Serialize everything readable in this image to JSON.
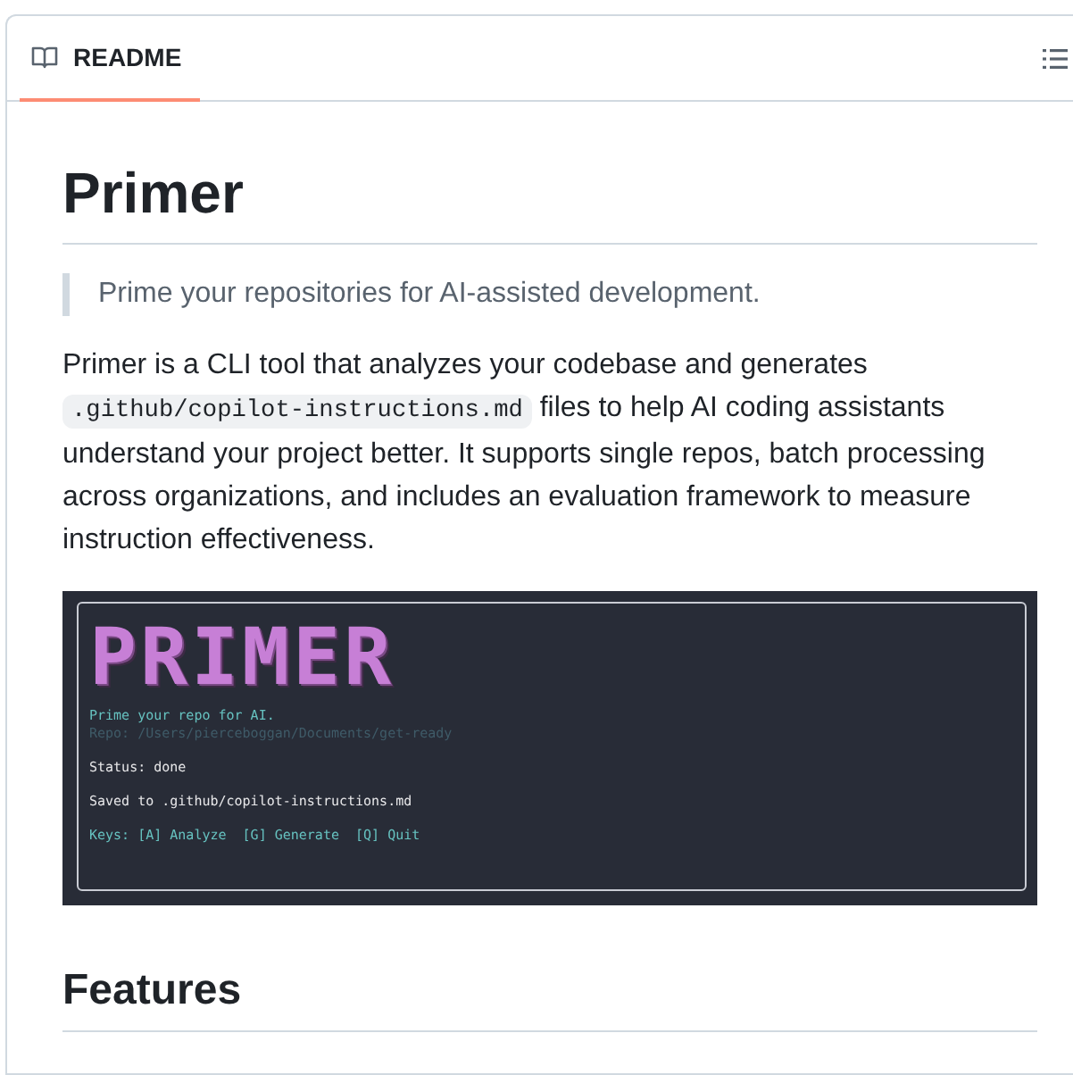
{
  "tab": {
    "label": "README",
    "selected": true
  },
  "title": "Primer",
  "quote": "Prime your repositories for AI-assisted development.",
  "intro": [
    {
      "kind": "text",
      "text": "Primer is a CLI tool that analyzes your codebase and generates "
    },
    {
      "kind": "code",
      "text": ".github/copilot-instructions.md"
    },
    {
      "kind": "text",
      "text": " files to help AI coding assistants understand your project better. It supports single repos, batch processing across organizations, and includes an evaluation framework to measure instruction effectiveness."
    }
  ],
  "terminal": {
    "banner": "PRIMER",
    "lines": [
      {
        "kind": "accent",
        "text": "Prime your repo for AI."
      },
      {
        "kind": "dim",
        "text": "Repo: /Users/pierceboggan/Documents/get-ready"
      },
      {
        "kind": "gap"
      },
      {
        "kind": "plain",
        "text": "Status: done"
      },
      {
        "kind": "gap"
      },
      {
        "kind": "plain",
        "text": "Saved to .github/copilot-instructions.md"
      },
      {
        "kind": "gap"
      },
      {
        "kind": "accent",
        "text": "Keys: [A] Analyze  [G] Generate  [Q] Quit"
      }
    ]
  },
  "features_heading": "Features"
}
